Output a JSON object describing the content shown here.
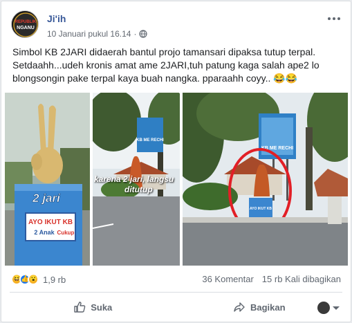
{
  "post": {
    "author": "Ji'ih",
    "timestamp": "10 Januari pukul 16.14",
    "privacy_icon": "globe-icon",
    "avatar_text_top": "REPUBLIK",
    "avatar_text_bottom": "NGANU",
    "text": "Simbol KB 2JARI didaerah bantul projo tamansari dipaksa tutup terpal. Setdaahh...udeh kronis amat ame 2JARI,tuh patung kaga salah ape2 lo blongsongin pake terpal kaya buah nangka. pparaahh coyy.. 😂😂"
  },
  "photos": {
    "left": {
      "sign_title": "2 jari",
      "banner_line1": "AYO IKUT KB",
      "banner_line2a": "2 Anak",
      "banner_line2b": "Cukup"
    },
    "middle": {
      "caption_line1": "karena 2 jari, langsu",
      "caption_line2": "ditutup",
      "billboard_text": "KB ME RECHI"
    },
    "right": {
      "billboard_text": "KB ME RECHI",
      "small_sign": "AYO IKUT KB"
    }
  },
  "stats": {
    "reaction_count": "1,9 rb",
    "comments": "36 Komentar",
    "shares": "15 rb Kali dibagikan"
  },
  "actions": {
    "like": "Suka",
    "share": "Bagikan"
  },
  "colors": {
    "author": "#385898",
    "like_blue": "#1877f2",
    "haha_yellow": "#f7b125",
    "text_gray": "#606770"
  }
}
